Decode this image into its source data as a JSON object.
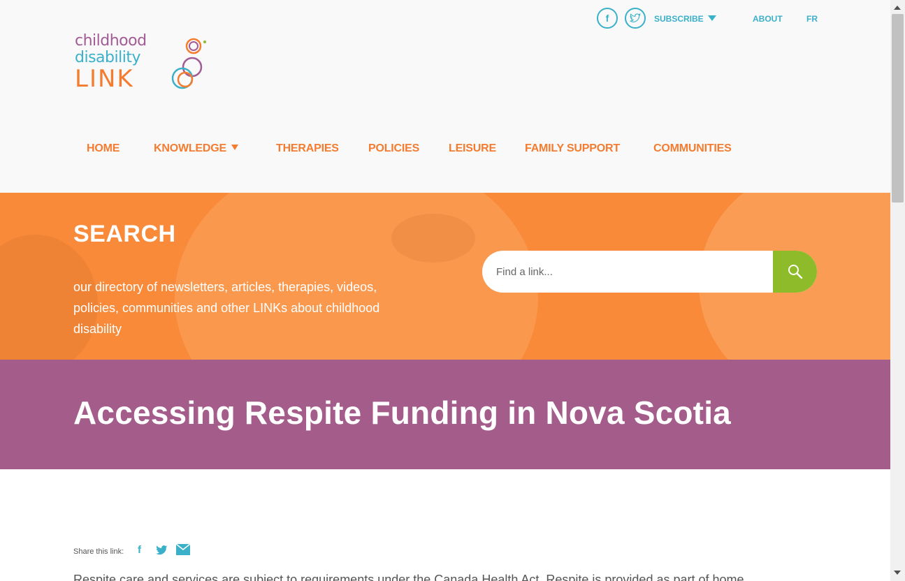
{
  "logo": {
    "line1": "childhood",
    "line2": "disability",
    "line3": "LINK"
  },
  "topbar": {
    "facebook_icon": "facebook-icon",
    "twitter_icon": "twitter-icon",
    "subscribe_label": "SUBSCRIBE",
    "about_label": "ABOUT",
    "lang_label": "FR"
  },
  "nav": {
    "items": [
      {
        "label": "HOME"
      },
      {
        "label": "KNOWLEDGE"
      },
      {
        "label": "THERAPIES"
      },
      {
        "label": "POLICIES"
      },
      {
        "label": "LEISURE"
      },
      {
        "label": "FAMILY SUPPORT"
      },
      {
        "label": "COMMUNITIES"
      }
    ]
  },
  "search": {
    "title": "SEARCH",
    "description": "our directory of newsletters, articles, therapies, videos, policies, communities and other LINKs about childhood disability",
    "placeholder": "Find a link..."
  },
  "page": {
    "title": "Accessing Respite Funding in Nova Scotia"
  },
  "share": {
    "label": "Share this link:"
  },
  "body": {
    "first_line": "Respite care and services are subject to requirements under the Canada Health Act. Respite is provided as part of home"
  },
  "colors": {
    "orange": "#f47c30",
    "teal": "#3bb0c9",
    "purple": "#a45c8a",
    "green": "#8dbb2a"
  }
}
